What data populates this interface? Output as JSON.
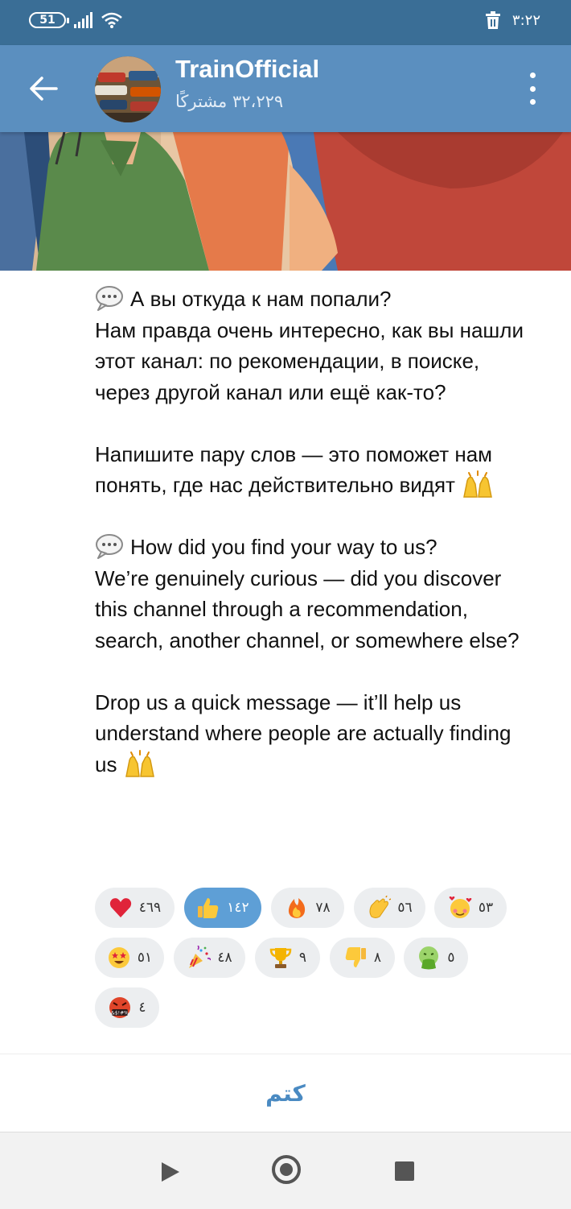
{
  "status_bar": {
    "battery": "51",
    "time": "۳:۲۲"
  },
  "header": {
    "title": "TrainOfficial",
    "subtitle": "۳۲،۲۲۹ مشترکًا"
  },
  "post": {
    "paragraphs": [
      "А вы откуда к нам попали?\nНам правда очень интересно, как вы нашли этот канал: по рекомендации, в поиске, через другой канал или ещё как-то?",
      "Напишите пару слов — это поможет нам понять, где нас действительно видят",
      "How did you find your way to us?\nWe’re genuinely curious — did you discover this channel through a recommendation, search, another channel, or somewhere else?",
      "Drop us a quick message — it’ll help us understand where people are actually finding us"
    ],
    "p1_line1": "А вы откуда к нам попали?",
    "p1_rest": "Нам правда очень интересно, как вы нашли этот канал: по рекомендации, в поиске, через другой канал или ещё как-то?",
    "p2": "Напишите пару слов — это поможет нам понять, где нас действительно видят",
    "p3_line1": "How did you find your way to us?",
    "p3_rest": "We’re genuinely curious — did you discover this channel through a recommendation, search, another channel, or somewhere else?",
    "p4": "Drop us a quick message — it’ll help us understand where people are actually finding us"
  },
  "reactions": [
    {
      "icon": "heart-icon",
      "count": "٤٦٩",
      "active": false
    },
    {
      "icon": "thumbs-up-icon",
      "count": "١٤٢",
      "active": true
    },
    {
      "icon": "fire-icon",
      "count": "٧٨",
      "active": false
    },
    {
      "icon": "clap-icon",
      "count": "٥٦",
      "active": false
    },
    {
      "icon": "smiling-hearts-icon",
      "count": "٥٣",
      "active": false
    },
    {
      "icon": "star-struck-icon",
      "count": "٥١",
      "active": false
    },
    {
      "icon": "party-popper-icon",
      "count": "٤٨",
      "active": false
    },
    {
      "icon": "trophy-icon",
      "count": "٩",
      "active": false
    },
    {
      "icon": "thumbs-down-icon",
      "count": "٨",
      "active": false
    },
    {
      "icon": "vomit-face-icon",
      "count": "٥",
      "active": false
    },
    {
      "icon": "cursing-face-icon",
      "count": "٤",
      "active": false
    }
  ],
  "footer": {
    "mute_label": "كتم"
  },
  "colors": {
    "header": "#5b8fbf",
    "status_bar": "#3a6e96",
    "accent": "#4a8ac2",
    "active_reaction": "#5e9fd6"
  }
}
